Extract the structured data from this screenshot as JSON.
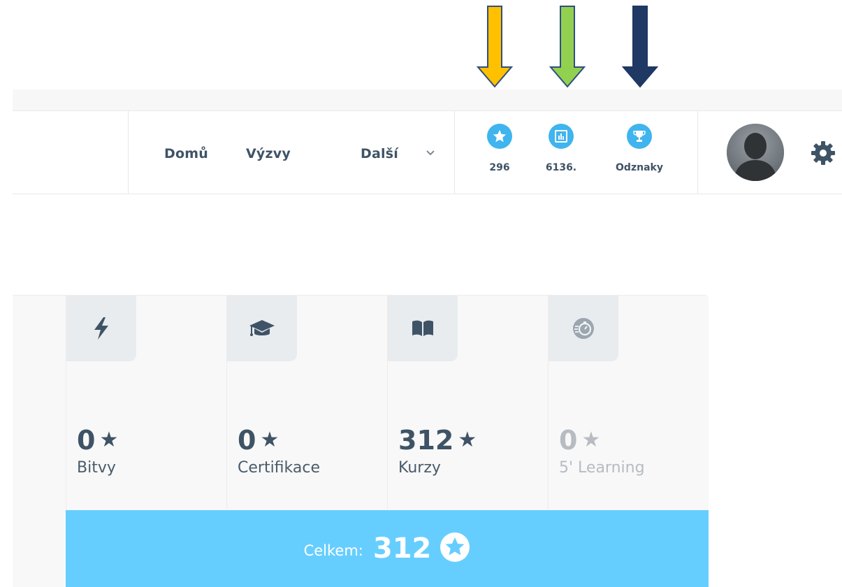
{
  "nav": {
    "links": [
      "Domů",
      "Výzvy",
      "Další"
    ],
    "stats": [
      {
        "icon": "star-icon",
        "label": "296"
      },
      {
        "icon": "leaderboard-icon",
        "label": "6136."
      },
      {
        "icon": "trophy-icon",
        "label": "Odznaky"
      }
    ]
  },
  "annotations": {
    "arrow_colors": [
      "#ffc000",
      "#92d050",
      "#1f3864"
    ]
  },
  "stats_card": {
    "columns": [
      {
        "icon": "lightning-icon",
        "value": "0",
        "label": "Bitvy"
      },
      {
        "icon": "graduation-cap-icon",
        "value": "0",
        "label": "Certifikace"
      },
      {
        "icon": "book-icon",
        "value": "312",
        "label": "Kurzy"
      },
      {
        "icon": "stopwatch-icon",
        "value": "0",
        "label": "5' Learning"
      }
    ],
    "total_label": "Celkem:",
    "total_value": "312",
    "star_glyph": "★"
  },
  "colors": {
    "accent": "#3fb4ee",
    "total_bg": "#66cefe",
    "text": "#3f5366"
  }
}
